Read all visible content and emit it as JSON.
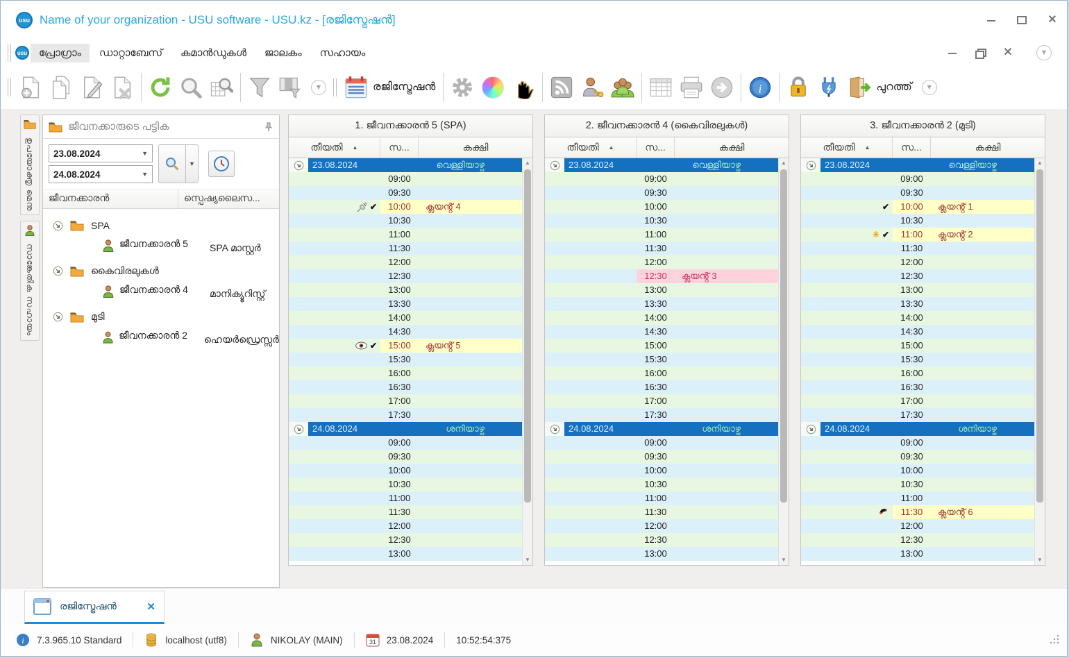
{
  "window": {
    "title": "Name of your organization - USU software - USU.kz - [രജിസ്ട്രേഷൻ]",
    "logo_text": "usu"
  },
  "menu": {
    "items": [
      "പ്രോഗ്രാം",
      "ഡാറ്റാബേസ്",
      "കമാൻഡുകൾ",
      "ജാലകം",
      "സഹായം"
    ]
  },
  "toolbar": {
    "report_label": "രജിസ്ട്രേഷൻ",
    "exit_label": "പുറത്ത്"
  },
  "side_tabs": [
    {
      "label": "ഉപയോക്തൃ മെനു",
      "icon": "folder-icon"
    },
    {
      "label": "സാങ്കേതിക സഹായം",
      "icon": "person-icon"
    }
  ],
  "employee_panel": {
    "title": "ജീവനക്കാരുടെ പട്ടിക",
    "date_from": "23.08.2024",
    "date_to": "24.08.2024",
    "columns": [
      "ജീവനക്കാരൻ",
      "സ്പെഷ്യലൈസ..."
    ],
    "groups": [
      {
        "name": "SPA",
        "employees": [
          {
            "name": "ജീവനക്കാരൻ 5",
            "specialization": "SPA മാസ്റ്റർ"
          }
        ]
      },
      {
        "name": "കൈവിരലുകൾ",
        "employees": [
          {
            "name": "ജീവനക്കാരൻ 4",
            "specialization": "മാനിക്യൂറിസ്റ്റ്"
          }
        ]
      },
      {
        "name": "മുടി",
        "employees": [
          {
            "name": "ജീവനക്കാരൻ 2",
            "specialization": "ഹെയർഡ്രെസ്സർ"
          }
        ]
      }
    ]
  },
  "schedule": {
    "columns_header": {
      "date": "തീയതി",
      "time": "സ...",
      "client": "കക്ഷി"
    },
    "days": [
      {
        "date": "23.08.2024",
        "weekday": "വെള്ളിയാഴ്ച"
      },
      {
        "date": "24.08.2024",
        "weekday": "ശനിയാഴ്ച"
      }
    ],
    "time_slots": {
      "day1": [
        "09:00",
        "09:30",
        "10:00",
        "10:30",
        "11:00",
        "11:30",
        "12:00",
        "12:30",
        "13:00",
        "13:30",
        "14:00",
        "14:30",
        "15:00",
        "15:30",
        "16:00",
        "16:30",
        "17:00",
        "17:30"
      ],
      "day2": [
        "09:00",
        "09:30",
        "10:00",
        "10:30",
        "11:00",
        "11:30",
        "12:00",
        "12:30",
        "13:00"
      ]
    },
    "panels": [
      {
        "title": "1. ജീവനക്കാരൻ 5 (SPA)",
        "appointments": [
          {
            "day": 0,
            "time": "10:00",
            "client": "ക്ലയൻ്റ് 4",
            "style": "yellow",
            "icons": [
              "syringe-icon",
              "check-icon"
            ]
          },
          {
            "day": 0,
            "time": "15:00",
            "client": "ക്ലയൻ്റ് 5",
            "style": "yellow",
            "icons": [
              "eye-icon",
              "check-icon"
            ]
          }
        ]
      },
      {
        "title": "2. ജീവനക്കാരൻ 4 (കൈവിരലുകൾ)",
        "appointments": [
          {
            "day": 0,
            "time": "12:30",
            "client": "ക്ലയൻ്റ് 3",
            "style": "pink",
            "icons": []
          }
        ]
      },
      {
        "title": "3. ജീവനക്കാരൻ 2 (മുടി)",
        "appointments": [
          {
            "day": 0,
            "time": "10:00",
            "client": "ക്ലയൻ്റ് 1",
            "style": "yellow",
            "icons": [
              "check-icon"
            ]
          },
          {
            "day": 0,
            "time": "11:00",
            "client": "ക്ലയൻ്റ് 2",
            "style": "yellow",
            "icons": [
              "burst-icon",
              "check-icon"
            ]
          },
          {
            "day": 1,
            "time": "11:30",
            "client": "ക്ലയൻ്റ് 6",
            "style": "yellow",
            "icons": [
              "phone-icon"
            ]
          }
        ]
      }
    ]
  },
  "bottom_tab": {
    "label": "രജിസ്ട്രേഷൻ"
  },
  "status_bar": {
    "version": "7.3.965.10 Standard",
    "database": "localhost (utf8)",
    "user": "NIKOLAY (MAIN)",
    "date": "23.08.2024",
    "time": "10:52:54:375"
  },
  "colors": {
    "accent_blue": "#1670c0",
    "title_blue": "#2aa9e0",
    "row_green": "#e7f7e2",
    "row_blue": "#dcf0fa",
    "appt_yellow": "#ffffc8",
    "appt_pink": "#ffd2de",
    "weekday_text": "#a5eeb5"
  }
}
